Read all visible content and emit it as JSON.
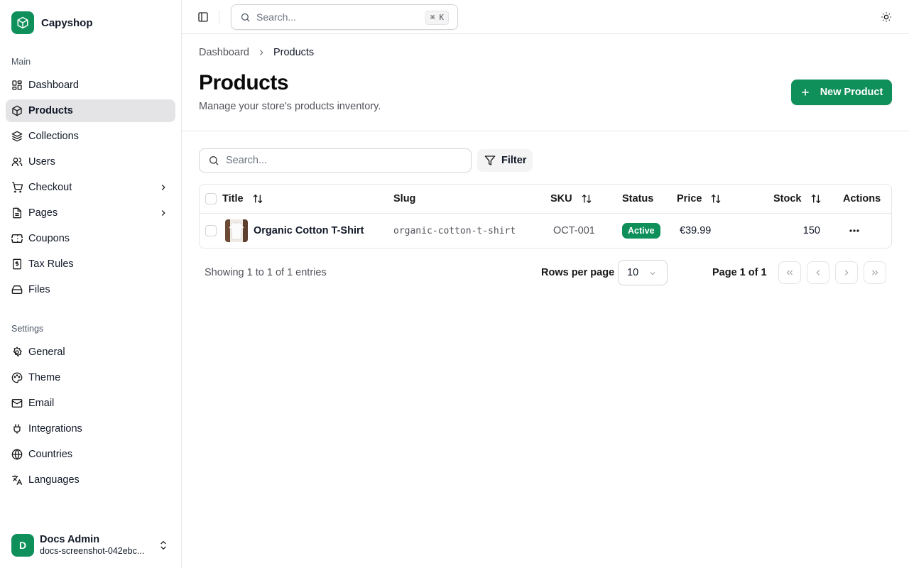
{
  "brand": {
    "name": "Capyshop",
    "logo_icon": "box-icon",
    "accent": "#0f8f5a"
  },
  "sidebar": {
    "main_label": "Main",
    "main_items": [
      {
        "label": "Dashboard",
        "icon": "dashboard-icon"
      },
      {
        "label": "Products",
        "icon": "box-icon",
        "active": true
      },
      {
        "label": "Collections",
        "icon": "layers-icon"
      },
      {
        "label": "Users",
        "icon": "users-icon"
      },
      {
        "label": "Checkout",
        "icon": "cart-icon",
        "has_submenu": true
      },
      {
        "label": "Pages",
        "icon": "file-icon",
        "has_submenu": true
      },
      {
        "label": "Coupons",
        "icon": "ticket-icon"
      },
      {
        "label": "Tax Rules",
        "icon": "receipt-icon"
      },
      {
        "label": "Files",
        "icon": "hard-drive-icon"
      }
    ],
    "settings_label": "Settings",
    "settings_items": [
      {
        "label": "General",
        "icon": "gear-icon"
      },
      {
        "label": "Theme",
        "icon": "palette-icon"
      },
      {
        "label": "Email",
        "icon": "mail-icon"
      },
      {
        "label": "Integrations",
        "icon": "plug-icon"
      },
      {
        "label": "Countries",
        "icon": "globe-icon"
      },
      {
        "label": "Languages",
        "icon": "translate-icon"
      }
    ],
    "user": {
      "initial": "D",
      "name": "Docs Admin",
      "email": "docs-screenshot-042ebc..."
    }
  },
  "topbar": {
    "search_placeholder": "Search...",
    "shortcut": "⌘ K"
  },
  "breadcrumb": {
    "parent": "Dashboard",
    "current": "Products"
  },
  "header": {
    "title": "Products",
    "subtitle": "Manage your store's products inventory.",
    "new_button": "New Product"
  },
  "toolbar": {
    "search_placeholder": "Search...",
    "filter_label": "Filter"
  },
  "table": {
    "columns": {
      "title": "Title",
      "slug": "Slug",
      "sku": "SKU",
      "status": "Status",
      "price": "Price",
      "stock": "Stock",
      "actions": "Actions"
    },
    "rows": [
      {
        "title": "Organic Cotton T-Shirt",
        "slug": "organic-cotton-t-shirt",
        "sku": "OCT-001",
        "status": "Active",
        "price": "€39.99",
        "stock": "150"
      }
    ]
  },
  "pagination": {
    "showing": "Showing 1 to 1 of 1 entries",
    "rows_per_page_label": "Rows per page",
    "rows_per_page_value": "10",
    "page_info": "Page 1 of 1"
  }
}
